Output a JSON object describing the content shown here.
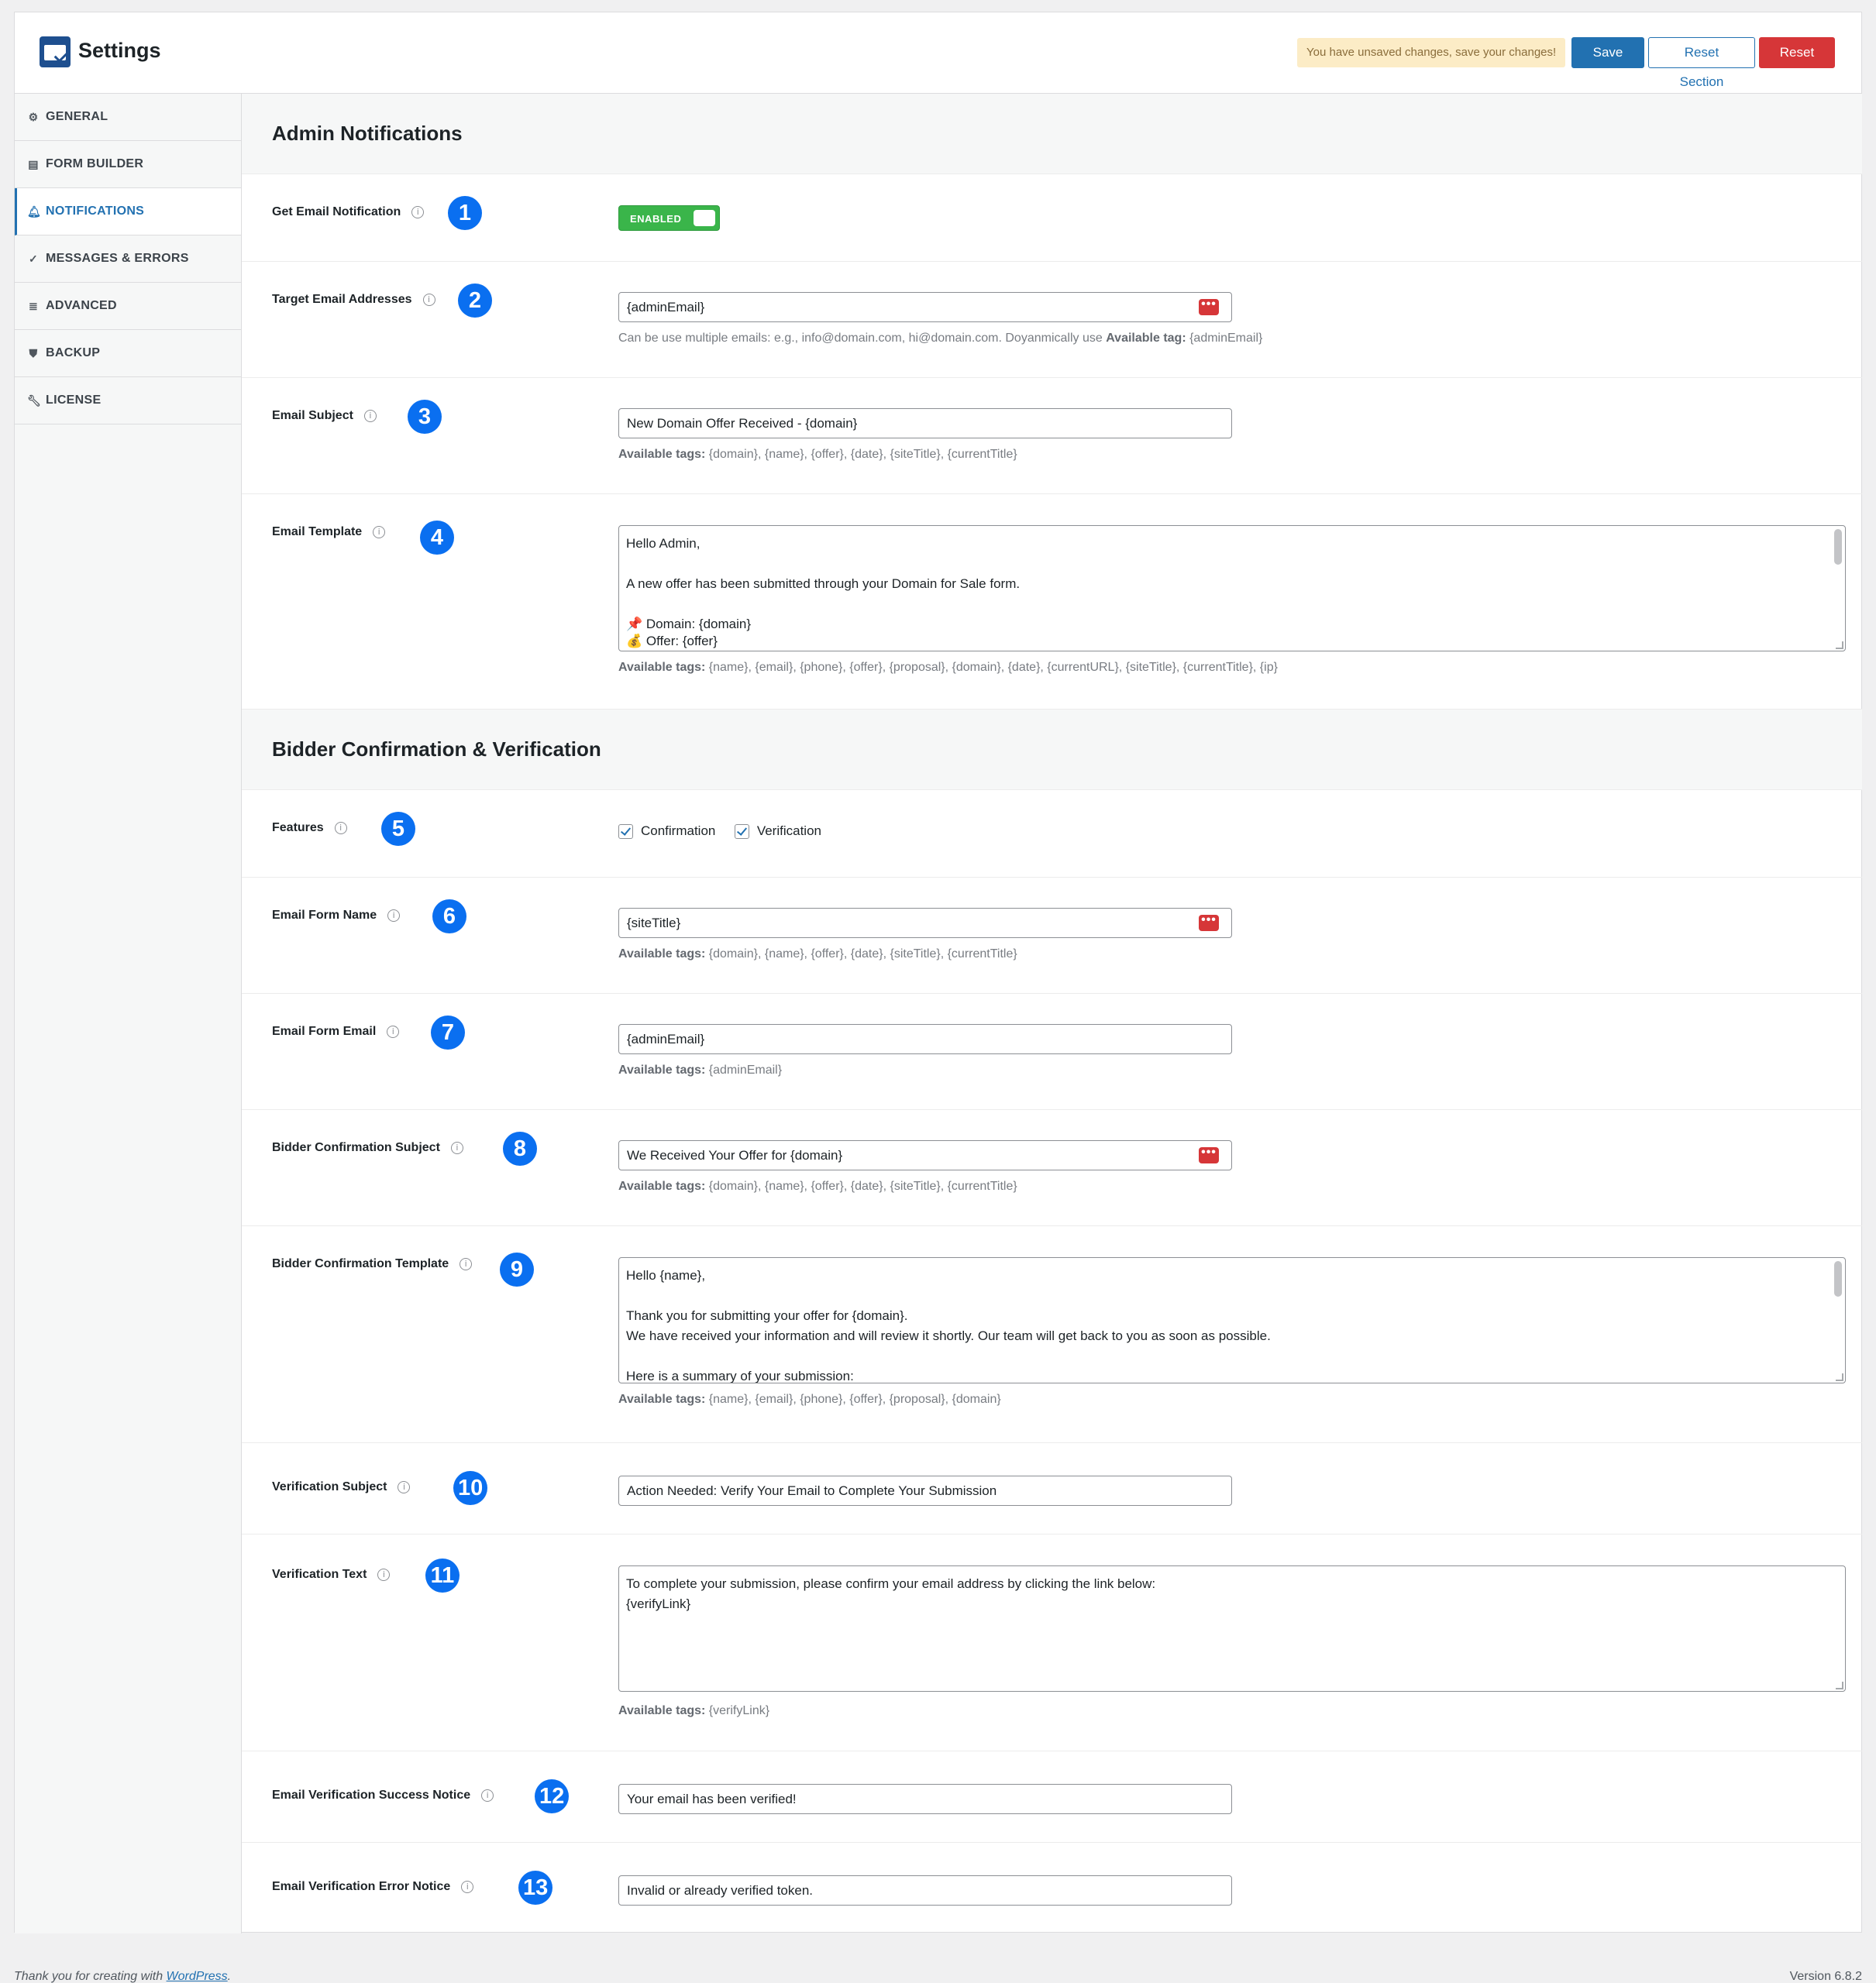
{
  "header": {
    "title": "Settings",
    "unsaved_notice": "You have unsaved changes, save your changes!",
    "save_label": "Save",
    "reset_section_label": "Reset Section",
    "reset_all_label": "Reset All"
  },
  "sidebar": {
    "items": [
      {
        "label": "GENERAL",
        "icon": "gear-icon"
      },
      {
        "label": "FORM BUILDER",
        "icon": "form-icon"
      },
      {
        "label": "NOTIFICATIONS",
        "icon": "bell-icon",
        "active": true
      },
      {
        "label": "MESSAGES & ERRORS",
        "icon": "check-circle-icon"
      },
      {
        "label": "ADVANCED",
        "icon": "database-icon"
      },
      {
        "label": "BACKUP",
        "icon": "shield-icon"
      },
      {
        "label": "LICENSE",
        "icon": "wrench-icon"
      }
    ]
  },
  "admin": {
    "title": "Admin Notifications",
    "get_email": {
      "label": "Get Email Notification",
      "badge": "1",
      "toggle": "ENABLED"
    },
    "target": {
      "label": "Target Email Addresses",
      "badge": "2",
      "value": "{adminEmail}",
      "help_pre": "Can be use multiple emails: e.g., info@domain.com, hi@domain.com. Doyanmically use ",
      "help_bold": "Available tag:",
      "help_tags": " {adminEmail}"
    },
    "subject": {
      "label": "Email Subject",
      "badge": "3",
      "value": "New Domain Offer Received - {domain}",
      "help_bold": "Available tags:",
      "help_tags": " {domain}, {name}, {offer}, {date}, {siteTitle}, {currentTitle}"
    },
    "template": {
      "label": "Email Template",
      "badge": "4",
      "lines": [
        "Hello Admin,",
        "",
        "A new offer has been submitted through your Domain for Sale form.",
        "",
        "📌 Domain: {domain}",
        "💰 Offer: {offer}"
      ],
      "help_bold": "Available tags:",
      "help_tags": " {name}, {email}, {phone}, {offer}, {proposal}, {domain}, {date}, {currentURL}, {siteTitle}, {currentTitle}, {ip}"
    }
  },
  "bidder": {
    "title": "Bidder Confirmation & Verification",
    "features": {
      "label": "Features",
      "badge": "5",
      "opt1": "Confirmation",
      "opt2": "Verification"
    },
    "form_name": {
      "label": "Email Form Name",
      "badge": "6",
      "value": "{siteTitle}",
      "help_bold": "Available tags:",
      "help_tags": " {domain}, {name}, {offer}, {date}, {siteTitle}, {currentTitle}"
    },
    "form_email": {
      "label": "Email Form Email",
      "badge": "7",
      "value": "{adminEmail}",
      "help_bold": "Available tags:",
      "help_tags": " {adminEmail}"
    },
    "conf_subject": {
      "label": "Bidder Confirmation Subject",
      "badge": "8",
      "value": "We Received Your Offer for {domain}",
      "help_bold": "Available tags:",
      "help_tags": " {domain}, {name}, {offer}, {date}, {siteTitle}, {currentTitle}"
    },
    "conf_template": {
      "label": "Bidder Confirmation Template",
      "badge": "9",
      "lines": [
        "Hello {name},",
        "",
        "Thank you for submitting your offer for {domain}.",
        "We have received your information and will review it shortly. Our team will get back to you as soon as possible.",
        "",
        "Here is a summary of your submission:"
      ],
      "help_bold": "Available tags:",
      "help_tags": " {name}, {email}, {phone}, {offer}, {proposal}, {domain}"
    },
    "ver_subject": {
      "label": "Verification Subject",
      "badge": "10",
      "value": "Action Needed: Verify Your Email to Complete Your Submission"
    },
    "ver_text": {
      "label": "Verification Text",
      "badge": "11",
      "lines": [
        "To complete your submission, please confirm your email address by clicking the link below:",
        "{verifyLink}"
      ],
      "help_bold": "Available tags:",
      "help_tags": " {verifyLink}"
    },
    "success": {
      "label": "Email Verification Success Notice",
      "badge": "12",
      "value": "Your email has been verified!"
    },
    "error": {
      "label": "Email Verification Error Notice",
      "badge": "13",
      "value": "Invalid or already verified token."
    }
  },
  "footer": {
    "thanks": "Thank you for creating with ",
    "wp": "WordPress",
    "thanks_end": ".",
    "version": "Version 6.8.2"
  }
}
